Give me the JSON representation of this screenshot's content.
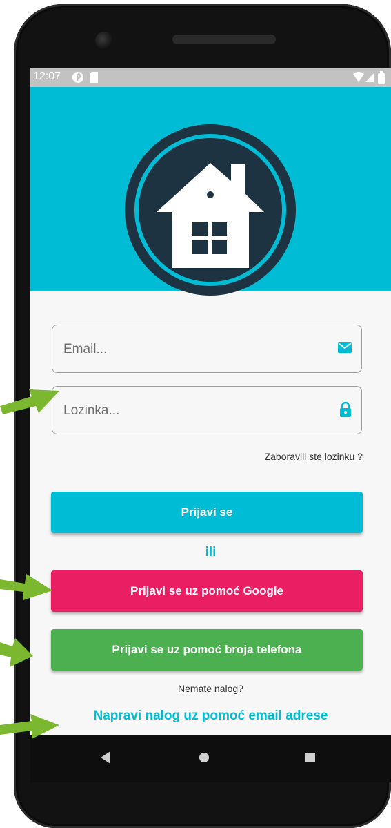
{
  "status_bar": {
    "time": "12:07",
    "icons": [
      "notification-app-icon",
      "sd-card-icon",
      "wifi-icon",
      "signal-icon",
      "battery-icon"
    ]
  },
  "header": {
    "background_color": "#00bcd4",
    "logo_icon": "house-logo-icon"
  },
  "form": {
    "email": {
      "placeholder": "Email...",
      "value": "",
      "icon": "envelope-icon"
    },
    "password": {
      "placeholder": "Lozinka...",
      "value": "",
      "icon": "lock-icon"
    },
    "forgot_password": "Zaboravili ste lozinku ?"
  },
  "buttons": {
    "login": "Prijavi se",
    "or": "ili",
    "google": "Prijavi se uz pomoć Google",
    "phone": "Prijavi se uz pomoć broja telefona"
  },
  "footer": {
    "no_account": "Nemate nalog?",
    "create_account": "Napravi nalog uz pomoć email adrese"
  },
  "navigation": [
    "back-icon",
    "home-icon",
    "recents-icon"
  ],
  "colors": {
    "accent": "#00bcd4",
    "google": "#e91e63",
    "phone": "#4caf50",
    "annotation_arrow": "#7cb82f"
  }
}
